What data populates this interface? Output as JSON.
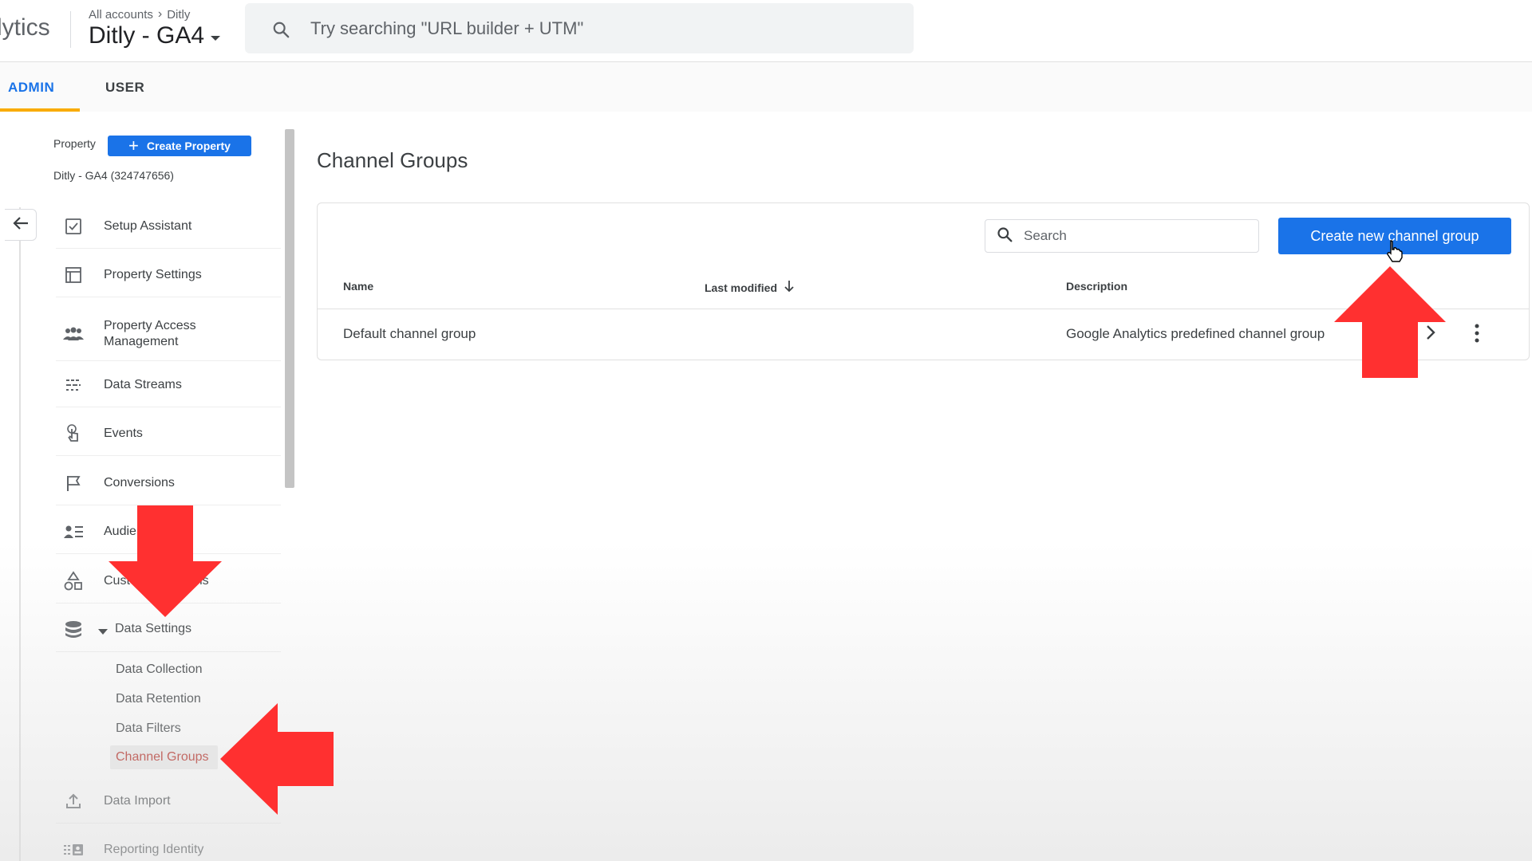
{
  "header": {
    "brand": "lytics",
    "breadcrumb": [
      "All accounts",
      "Ditly"
    ],
    "account_name": "Ditly - GA4",
    "search_placeholder": "Try searching \"URL builder + UTM\""
  },
  "tabs": [
    {
      "label": "ADMIN",
      "active": true
    },
    {
      "label": "USER",
      "active": false
    }
  ],
  "property": {
    "label": "Property",
    "create_button": "Create Property",
    "id_text": "Ditly - GA4 (324747656)"
  },
  "nav": {
    "items": [
      {
        "label": "Setup Assistant",
        "icon": "checkbox-icon"
      },
      {
        "label": "Property Settings",
        "icon": "settings-window-icon"
      },
      {
        "label": "Property Access Management",
        "icon": "people-icon"
      },
      {
        "label": "Data Streams",
        "icon": "data-streams-icon"
      },
      {
        "label": "Events",
        "icon": "touch-icon"
      },
      {
        "label": "Conversions",
        "icon": "flag-icon"
      },
      {
        "label": "Audiences",
        "icon": "audience-icon"
      },
      {
        "label": "Custom definitions",
        "icon": "shapes-icon"
      }
    ],
    "data_settings": {
      "label": "Data Settings",
      "expanded": true,
      "children": [
        {
          "label": "Data Collection",
          "active": false
        },
        {
          "label": "Data Retention",
          "active": false
        },
        {
          "label": "Data Filters",
          "active": false
        },
        {
          "label": "Channel Groups",
          "active": true
        }
      ]
    },
    "after_items": [
      {
        "label": "Data Import",
        "icon": "upload-icon"
      },
      {
        "label": "Reporting Identity",
        "icon": "reporting-identity-icon"
      }
    ]
  },
  "main": {
    "title": "Channel Groups",
    "search_placeholder": "Search",
    "create_button": "Create new channel group",
    "columns": [
      "Name",
      "Last modified",
      "Description"
    ],
    "rows": [
      {
        "name": "Default channel group",
        "last_modified": "",
        "description": "Google Analytics predefined channel group"
      }
    ]
  },
  "colors": {
    "accent": "#1a73e8",
    "active_link": "#b3261e",
    "annotation_arrow": "#ff3030",
    "tab_underline": "#f9ab00"
  }
}
